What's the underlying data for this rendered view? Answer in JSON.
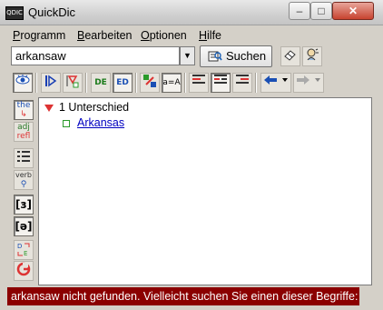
{
  "window": {
    "title": "QuickDic",
    "icon_text": "QDIC"
  },
  "menu": [
    {
      "label": "Programm",
      "mnemonic": "P",
      "rest": "rogramm"
    },
    {
      "label": "Bearbeiten",
      "mnemonic": "B",
      "rest": "earbeiten"
    },
    {
      "label": "Optionen",
      "mnemonic": "O",
      "rest": "ptionen"
    },
    {
      "label": "Hilfe",
      "mnemonic": "H",
      "rest": "ilfe"
    }
  ],
  "search": {
    "value": "arkansaw",
    "button_label": "Suchen"
  },
  "toolbar": {
    "de_en": "DE",
    "en_de": "ED",
    "case_label": "a=A"
  },
  "sidebar": {
    "the": "the",
    "adj": "adj",
    "refl": "refl",
    "verb": "verb",
    "phon1": "[з]",
    "phon2": "[ə]"
  },
  "results": {
    "header": "1 Unterschied",
    "items": [
      "Arkansas"
    ]
  },
  "status": {
    "text": "arkansaw nicht gefunden. Vielleicht suchen Sie einen dieser Begriffe:"
  },
  "colors": {
    "status_bg": "#8b0000",
    "link": "#0000c0",
    "accent_red": "#d33333",
    "accent_green": "#2a9a2a"
  }
}
